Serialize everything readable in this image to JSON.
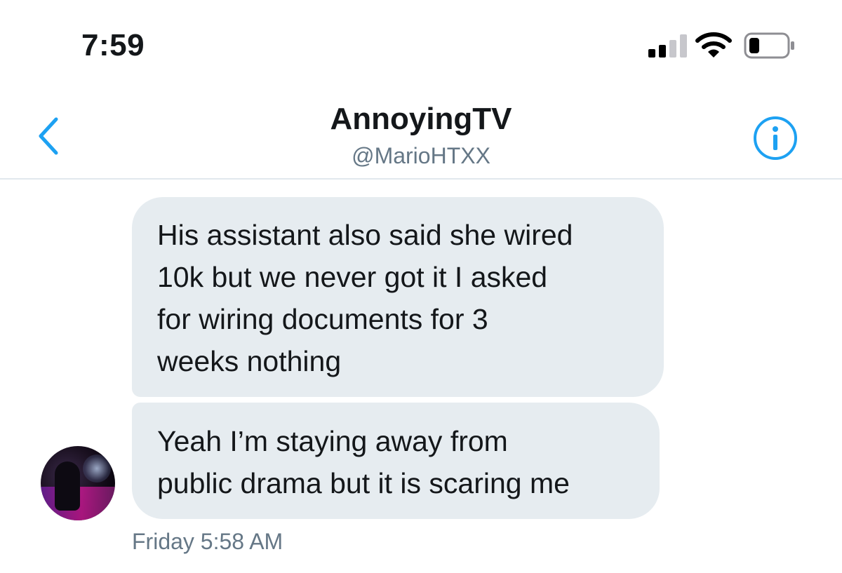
{
  "status_bar": {
    "time": "7:59",
    "icons": [
      "cellular-signal-icon",
      "wifi-icon",
      "battery-icon"
    ]
  },
  "header": {
    "title": "AnnoyingTV",
    "handle": "@MarioHTXX",
    "icons": [
      "back-chevron-icon",
      "info-icon"
    ],
    "accent_color": "#1da1f2"
  },
  "messages": [
    {
      "text": "His assistant also said she wired 10k but we never got it I asked for wiring documents for 3 weeks nothing",
      "lines": [
        "His assistant also said she wired",
        "10k but we never got it I asked",
        "for wiring documents for 3",
        "weeks nothing"
      ]
    },
    {
      "text": "Yeah I’m staying away from public drama but it is scaring me",
      "lines": [
        "Yeah I’m staying away from",
        "public drama but it is scaring me"
      ]
    }
  ],
  "timestamp": "Friday 5:58 AM",
  "colors": {
    "bubble": "#e6ecf0",
    "text": "#14171a",
    "secondary_text": "#657786",
    "divider": "#e1e8ed"
  }
}
